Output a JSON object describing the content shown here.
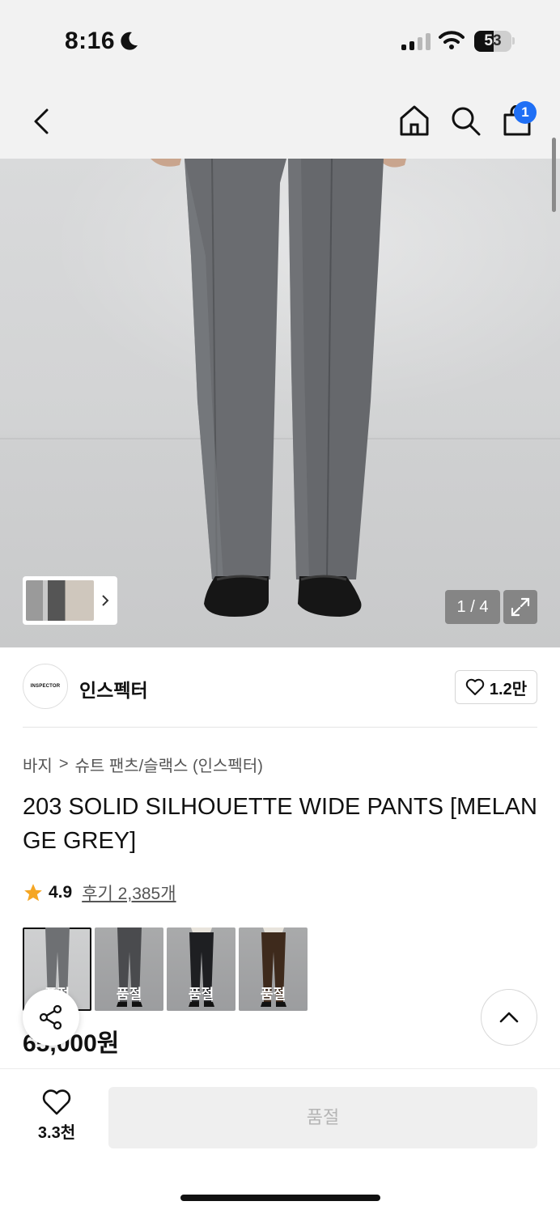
{
  "status_bar": {
    "time": "8:16",
    "battery": "53"
  },
  "nav": {
    "cart_count": "1"
  },
  "gallery": {
    "counter": "1 / 4",
    "product_image": "model wearing grey wide pants with black loafers"
  },
  "brand": {
    "logo_text": "INSPECTOR",
    "name": "인스펙터",
    "likes": "1.2만"
  },
  "breadcrumb": {
    "category": "바지",
    "separator": ">",
    "subcategory": "슈트 팬츠/슬랙스 (인스펙터)"
  },
  "product": {
    "title": "203 SOLID SILHOUETTE WIDE PANTS [MELANGE GREY]",
    "rating": "4.9",
    "reviews": "후기 2,385개",
    "price": "65,000원"
  },
  "variants": [
    {
      "label": "품절",
      "color": "#6e7073",
      "selected": true
    },
    {
      "label": "품절",
      "color": "#4a4b4e",
      "selected": false
    },
    {
      "label": "품절",
      "color": "#1e1f22",
      "selected": false
    },
    {
      "label": "품절",
      "color": "#3e2a1c",
      "selected": false
    }
  ],
  "bottom_bar": {
    "wish_count": "3.3천",
    "buy_label": "품절"
  },
  "colors": {
    "accent": "#1f6ff5",
    "star": "#f5a623"
  }
}
